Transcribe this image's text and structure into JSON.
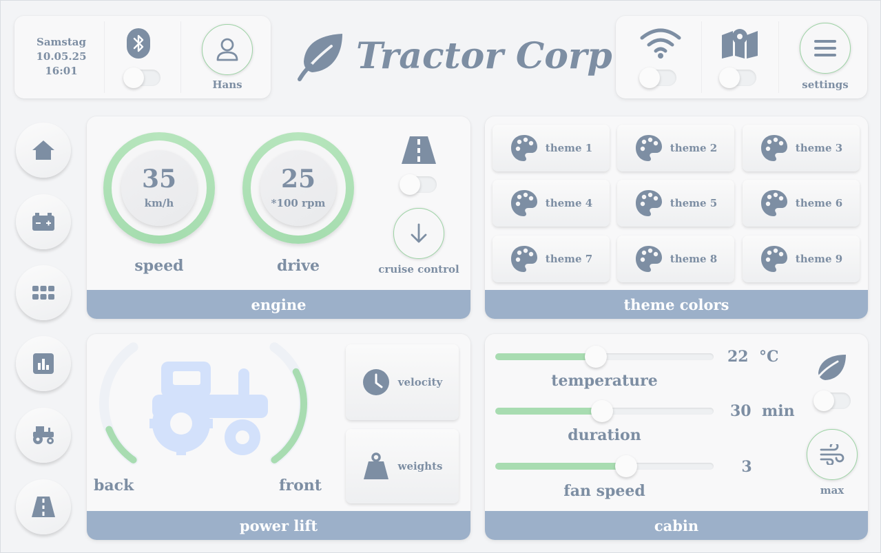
{
  "header": {
    "date": {
      "day": "Samstag",
      "date": "10.05.25",
      "time": "16:01"
    },
    "user": "Hans",
    "brand": "Tractor Corp",
    "settings": "settings"
  },
  "sidebar": {
    "items": [
      {
        "icon": "home-icon"
      },
      {
        "icon": "battery-icon"
      },
      {
        "icon": "apps-grid-icon"
      },
      {
        "icon": "chart-icon"
      },
      {
        "icon": "tractor-settings-icon"
      },
      {
        "icon": "road-icon"
      }
    ]
  },
  "engine": {
    "title": "engine",
    "speed": {
      "value": "35",
      "unit": "km/h",
      "label": "speed"
    },
    "drive": {
      "value": "25",
      "unit": "*100 rpm",
      "label": "drive"
    },
    "cruise_label": "cruise control"
  },
  "themes": {
    "title": "theme colors",
    "items": [
      "theme 1",
      "theme 2",
      "theme 3",
      "theme 4",
      "theme 5",
      "theme 6",
      "theme 7",
      "theme 8",
      "theme 9"
    ]
  },
  "power_lift": {
    "title": "power lift",
    "back": "back",
    "front": "front",
    "back_level": 0.3,
    "front_level": 0.75,
    "velocity": "velocity",
    "weights": "weights"
  },
  "cabin": {
    "title": "cabin",
    "temperature": {
      "value": "22",
      "unit": "°C",
      "label": "temperature",
      "level": 0.46
    },
    "duration": {
      "value": "30",
      "unit": "min",
      "label": "duration",
      "level": 0.49
    },
    "fan": {
      "value": "3",
      "unit": "",
      "label": "fan speed",
      "level": 0.6
    },
    "max_label": "max"
  },
  "colors": {
    "accent_green": "#a8dcb1",
    "footer_blue": "#9cb0c9",
    "icon_gray": "#7d8ea3"
  }
}
